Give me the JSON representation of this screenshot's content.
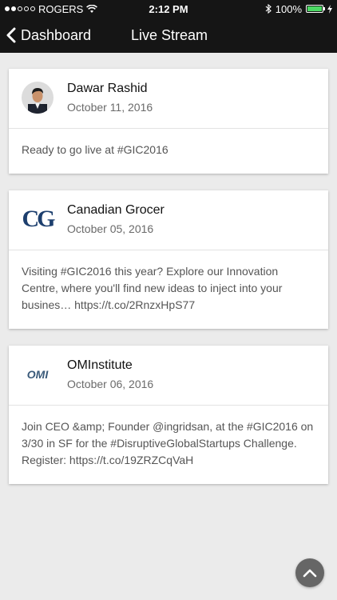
{
  "status_bar": {
    "carrier": "ROGERS",
    "time": "2:12 PM",
    "battery": "100%",
    "signal_bars_filled": 2,
    "signal_bars_total": 5
  },
  "nav": {
    "back_label": "Dashboard",
    "title": "Live Stream"
  },
  "posts": [
    {
      "name": "Dawar Rashid",
      "date": "October 11, 2016",
      "text": "Ready to go live at #GIC2016",
      "avatar_icon": "person-photo"
    },
    {
      "name": "Canadian Grocer",
      "date": "October 05, 2016",
      "text": "Visiting #GIC2016 this year? Explore our Innovation Centre, where you'll find new ideas to inject into your busines… https://t.co/2RnzxHpS77",
      "logo_text": "CG",
      "logo_color": "#1d3f6e"
    },
    {
      "name": "OMInstitute",
      "date": "October 06, 2016",
      "text": "Join CEO &amp; Founder @ingridsan, at the #GIC2016 on 3/30 in SF for the #DisruptiveGlobalStartups Challenge. Register: https://t.co/19ZRZCqVaH",
      "logo_text": "OMI",
      "logo_color": "#3a5a7a"
    }
  ],
  "colors": {
    "topbar": "#151515",
    "background": "#ebebeb",
    "battery": "#4cd964",
    "fab": "#666666"
  }
}
